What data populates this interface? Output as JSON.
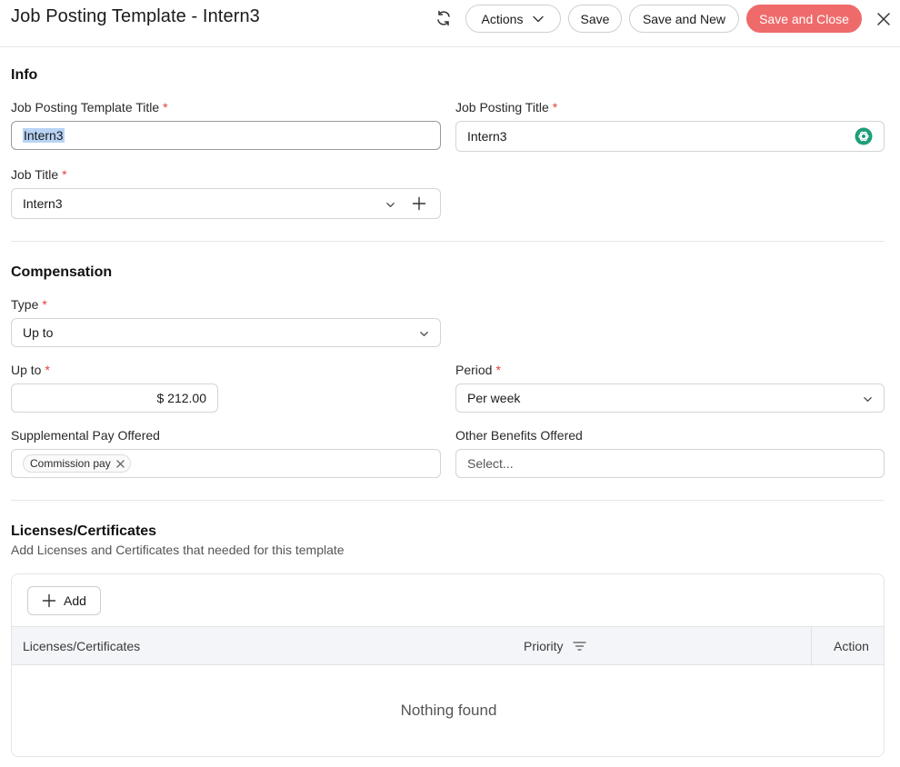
{
  "header": {
    "title": "Job Posting Template - Intern3",
    "actions_label": "Actions",
    "save_label": "Save",
    "save_new_label": "Save and New",
    "save_close_label": "Save and Close"
  },
  "info": {
    "section_title": "Info",
    "template_title_label": "Job Posting Template Title",
    "template_title_value": "Intern3",
    "posting_title_label": "Job Posting Title",
    "posting_title_value": "Intern3",
    "job_title_label": "Job Title",
    "job_title_value": "Intern3",
    "required_mark": "*"
  },
  "compensation": {
    "section_title": "Compensation",
    "type_label": "Type",
    "type_value": "Up to",
    "upto_label": "Up to",
    "upto_value": "$ 212.00",
    "period_label": "Period",
    "period_value": "Per week",
    "supp_label": "Supplemental Pay Offered",
    "supp_chip": "Commission pay",
    "benefits_label": "Other Benefits Offered",
    "benefits_placeholder": "Select..."
  },
  "licenses": {
    "section_title": "Licenses/Certificates",
    "subtitle": "Add Licenses and Certificates that needed for this template",
    "add_label": "Add",
    "columns": [
      "Licenses/Certificates",
      "Priority",
      "Action"
    ],
    "empty_text": "Nothing found"
  },
  "colors": {
    "accent": "#ef6b6b",
    "required": "#e2423f",
    "ai_icon": "#1f9e7a"
  }
}
